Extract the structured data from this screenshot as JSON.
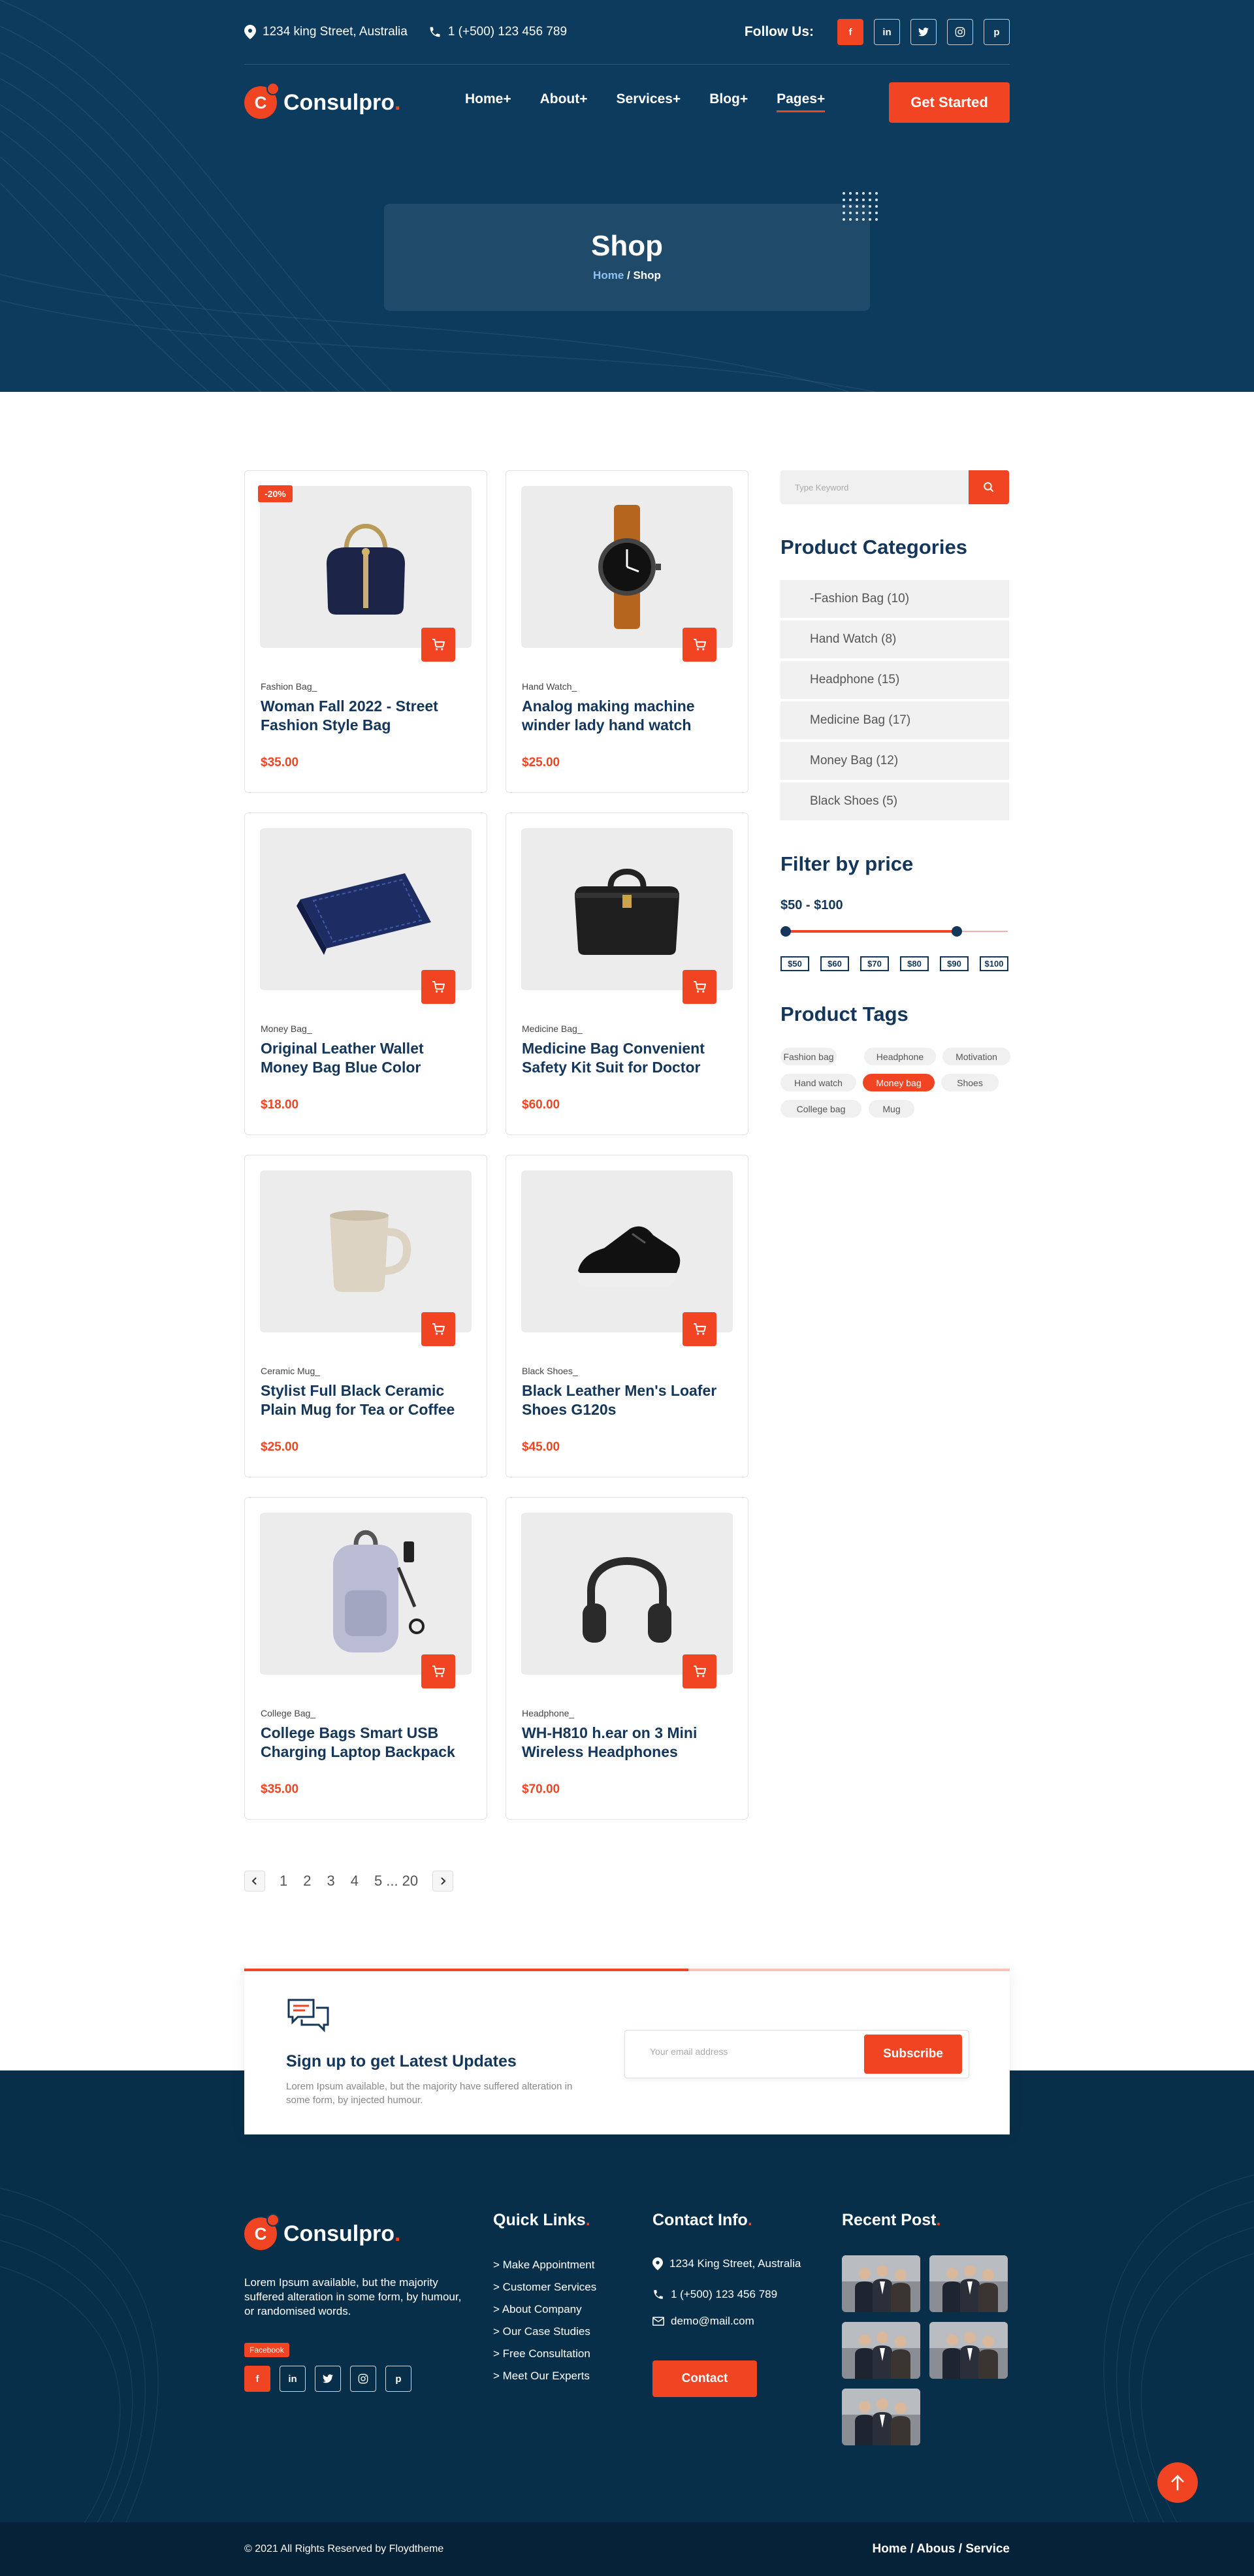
{
  "topbar": {
    "address": "1234 king Street, Australia",
    "phone": "1 (+500) 123 456 789",
    "follow_label": "Follow Us:",
    "socials": [
      "f",
      "in",
      "t",
      "ig",
      "p"
    ]
  },
  "brand": {
    "name": "Consulpro",
    "dot": ".",
    "mark": "C"
  },
  "nav": {
    "items": [
      "Home+",
      "About+",
      "Services+",
      "Blog+",
      "Pages+"
    ],
    "cta": "Get Started"
  },
  "page_title": {
    "title": "Shop",
    "crumb_home": "Home",
    "crumb_sep": " / ",
    "crumb_current": "Shop"
  },
  "products": [
    {
      "category": "Fashion Bag_",
      "name": "Woman Fall 2022 - Street Fashion Style Bag",
      "price": "$35.00",
      "badge": "-20%",
      "icon": "handbag"
    },
    {
      "category": "Hand Watch_",
      "name": "Analog making machine winder lady hand watch",
      "price": "$25.00",
      "icon": "watch"
    },
    {
      "category": "Money Bag_",
      "name": "Original Leather Wallet Money Bag Blue Color",
      "price": "$18.00",
      "icon": "wallet"
    },
    {
      "category": "Medicine Bag_",
      "name": "Medicine Bag Convenient Safety Kit Suit for Doctor",
      "price": "$60.00",
      "icon": "doctor-bag"
    },
    {
      "category": "Ceramic Mug_",
      "name": "Stylist Full Black Ceramic Plain Mug for Tea or Coffee",
      "price": "$25.00",
      "icon": "mug"
    },
    {
      "category": "Black Shoes_",
      "name": "Black Leather Men's Loafer Shoes G120s",
      "price": "$45.00",
      "icon": "shoe"
    },
    {
      "category": "College Bag_",
      "name": "College Bags Smart USB Charging Laptop Backpack",
      "price": "$35.00",
      "icon": "backpack"
    },
    {
      "category": "Headphone_",
      "name": "WH-H810 h.ear on 3 Mini Wireless Headphones",
      "price": "$70.00",
      "icon": "headphones"
    }
  ],
  "pagination": {
    "pages": [
      "1",
      "2",
      "3",
      "4",
      "5",
      "...",
      "20"
    ]
  },
  "sidebar": {
    "search_placeholder": "Type Keyword",
    "categories_title": "Product Categories",
    "categories": [
      "-Fashion Bag (10)",
      "Hand Watch (8)",
      "Headphone (15)",
      "Medicine Bag (17)",
      "Money Bag (12)",
      "Black Shoes (5)"
    ],
    "price_title": "Filter by price",
    "price_range": "$50 - $100",
    "price_min": 50,
    "price_max": 100,
    "price_fill": 0.77,
    "price_steps": [
      "$50",
      "$60",
      "$70",
      "$80",
      "$90",
      "$100"
    ],
    "tags_title": "Product Tags",
    "tags": [
      {
        "label": "Fashion bag",
        "active": false
      },
      {
        "label": "Headphone",
        "active": false
      },
      {
        "label": "Motivation",
        "active": false
      },
      {
        "label": "Hand watch",
        "active": false
      },
      {
        "label": "Money bag",
        "active": true
      },
      {
        "label": "Shoes",
        "active": false
      },
      {
        "label": "College bag",
        "active": false
      },
      {
        "label": "Mug",
        "active": false
      }
    ]
  },
  "newsletter": {
    "title": "Sign up to get Latest Updates",
    "text": "Lorem Ipsum available, but the majority have suffered alteration in some form, by injected humour.",
    "placeholder": "Your email address",
    "button": "Subscribe"
  },
  "footer": {
    "about": "Lorem Ipsum available, but the majority suffered alteration in some form, by humour, or randomised words.",
    "facebook_badge": "Facebook",
    "quick_title": "Quick Links",
    "quick_links": [
      "> Make Appointment",
      "> Customer Services",
      "> About Company",
      "> Our Case Studies",
      "> Free Consultation",
      "> Meet Our Experts"
    ],
    "contact_title": "Contact Info",
    "contact_address": "1234 King Street, Australia",
    "contact_phone": "1 (+500) 123 456 789",
    "contact_email": "demo@mail.com",
    "contact_button": "Contact",
    "recent_title": "Recent Post",
    "copyright": "© 2021 All Rights Reserved by Floydtheme",
    "bottom_links": [
      "Home",
      "Abous",
      "Service"
    ],
    "colors": {
      "primary": "#0d3b5e",
      "accent": "#f04423",
      "footer": "#082f4a"
    }
  }
}
